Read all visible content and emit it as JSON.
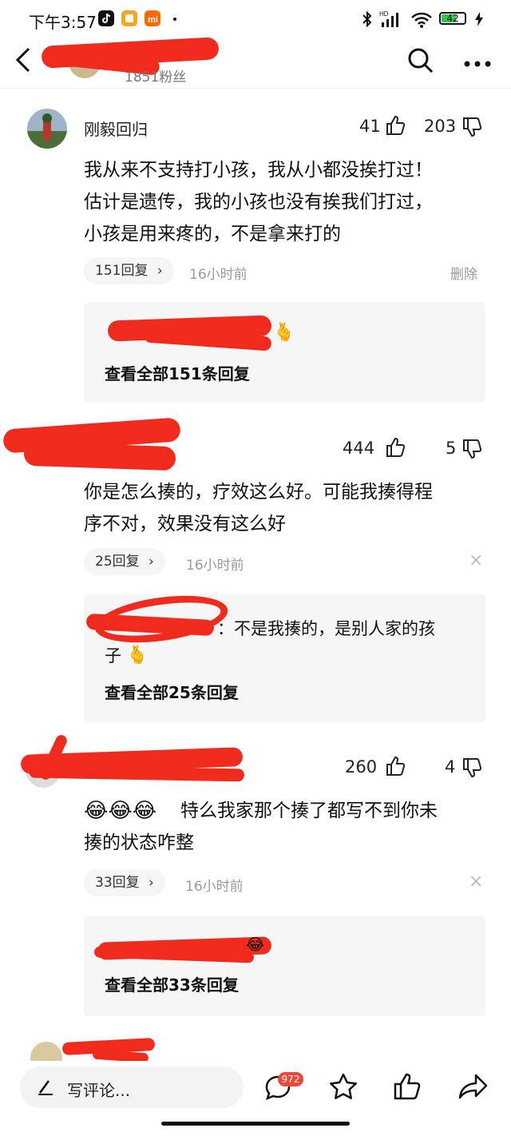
{
  "status_bar": {
    "time": "下午3:57",
    "battery": "42",
    "signal_label": "HD"
  },
  "header": {
    "fans": "1851粉丝",
    "back_icon": "chevron-left-icon",
    "search_icon": "search-icon",
    "more_icon": "more-icon"
  },
  "comments": [
    {
      "name": "刚毅回归",
      "likes": "41",
      "dislikes": "203",
      "text_lines": [
        "我从来不支持打小孩，我从小都没挨打过！",
        "估计是遗传，我的小孩也没有挨我们打过，",
        "小孩是用来疼的，不是拿来打的"
      ],
      "reply_count": "151回复",
      "time": "16小时前",
      "action": "删除",
      "preview_line1": "",
      "preview_line2": "",
      "view_all": "查看全部151条回复"
    },
    {
      "name": "",
      "likes": "444",
      "dislikes": "5",
      "text_lines": [
        "你是怎么揍的，疗效这么好。可能我揍得程",
        "序不对，效果没有这么好"
      ],
      "reply_count": "25回复",
      "time": "16小时前",
      "action": "×",
      "preview_line1": "：不是我揍的，是别人家的孩",
      "preview_line2": "子",
      "view_all": "查看全部25条回复"
    },
    {
      "name": "",
      "likes": "260",
      "dislikes": "4",
      "text_lines": [
        "特么我家那个揍了都写不到你未",
        "揍的状态咋整"
      ],
      "reply_count": "33回复",
      "time": "16小时前",
      "action": "×",
      "view_all": "查看全部33条回复"
    }
  ],
  "bottom_bar": {
    "input_label": "写评论...",
    "comment_badge": "972"
  },
  "colors": {
    "accent_red": "#f0463a",
    "redaction": "#f02a1d",
    "pill_bg": "#f5f5f5"
  }
}
